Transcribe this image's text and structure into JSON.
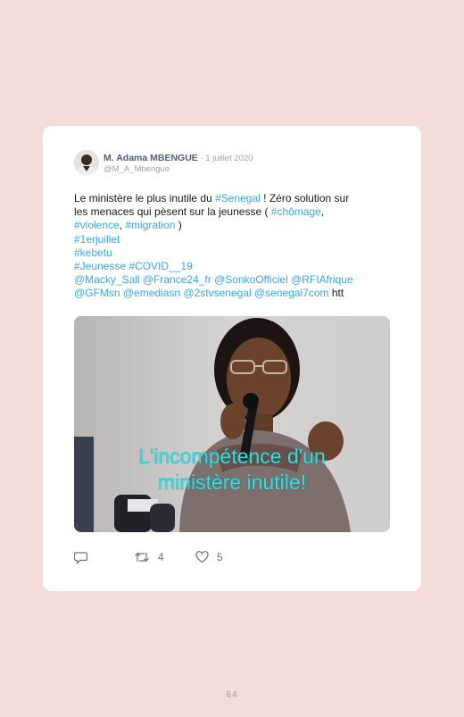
{
  "tweet": {
    "author_name": "M. Adama MBENGUE",
    "date": " · 1 juillet 2020",
    "handle": "@M_A_Mbengue",
    "text": {
      "l1_a": "Le ministère le plus inutile du ",
      "l1_tag": "#Senegal",
      "l1_b": " ! Zéro solution sur",
      "l2_a": "les menaces qui pèsent sur la jeunesse ( ",
      "l2_tag": "#chômage",
      "l2_b": ",",
      "l3_tag1": "#violence",
      "l3_sep": ", ",
      "l3_tag2": "#migration",
      "l3_b": " )",
      "l4": "#1erjuillet",
      "l5": "#kebetu",
      "l6": "#Jeunesse #COVID__19",
      "l7": "@Macky_Sall @France24_fr @SonkoOfficiel @RFIAfrique",
      "l8_mentions": "@GFMsn @emediasn @2stvsenegal @senegal7com",
      "l8_b": " htt"
    },
    "media_caption_line1": "L'incompétence d'un",
    "media_caption_line2": "ministère inutile!",
    "actions": {
      "reply_icon": "reply-icon",
      "retweet_icon": "retweet-icon",
      "retweet_count": "4",
      "like_icon": "heart-icon",
      "like_count": "5"
    }
  },
  "page_number": "64",
  "colors": {
    "page_bg": "#f4dcda",
    "card_bg": "#ffffff",
    "link": "#38a7e8",
    "caption": "#2fe0e3"
  }
}
